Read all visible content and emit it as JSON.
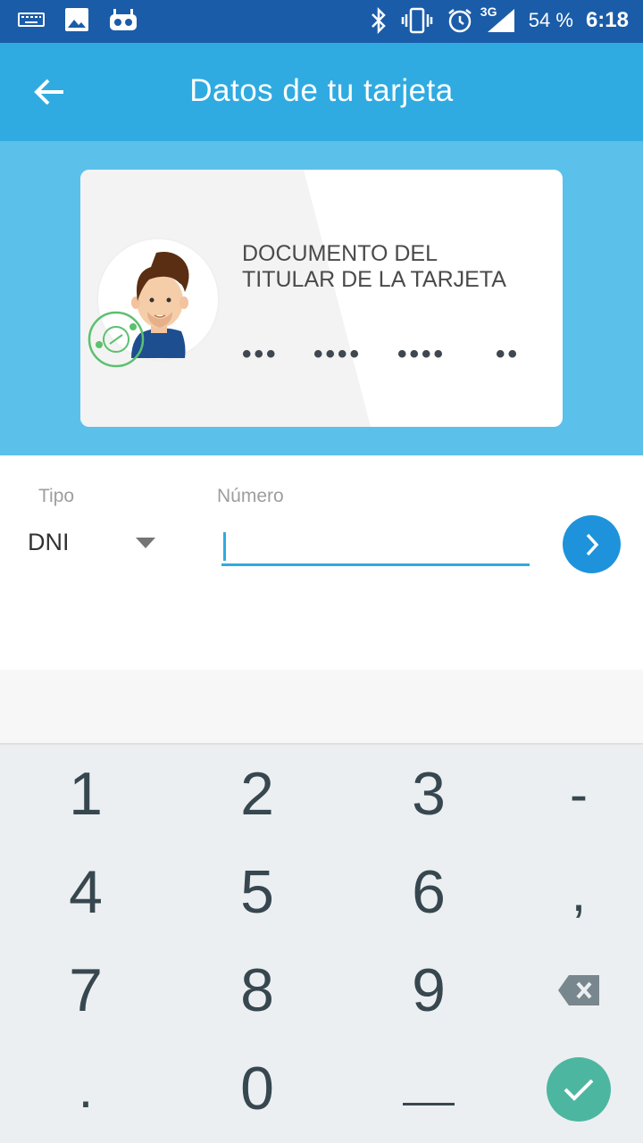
{
  "status_bar": {
    "network": "3G",
    "battery": "54 %",
    "time": "6:18",
    "icons": [
      "keyboard-icon",
      "image-icon",
      "robot-icon",
      "bluetooth-icon",
      "vibrate-icon",
      "alarm-icon",
      "signal-icon"
    ]
  },
  "app_bar": {
    "title": "Datos de tu tarjeta",
    "back_icon": "arrow-left-icon"
  },
  "card": {
    "title_line1": "DOCUMENTO DEL",
    "title_line2": "TITULAR DE LA TARJETA",
    "dots": [
      "•••",
      "••••",
      "••••",
      "••"
    ]
  },
  "form": {
    "tipo_label": "Tipo",
    "tipo_value": "DNI",
    "numero_label": "Número",
    "numero_value": "",
    "numero_placeholder": ""
  },
  "keypad": {
    "keys": [
      "1",
      "2",
      "3",
      "-",
      "4",
      "5",
      "6",
      ",",
      "7",
      "8",
      "9",
      "backspace",
      ".",
      "0",
      "_",
      "done"
    ]
  },
  "colors": {
    "status_bar": "#1a5ca8",
    "app_bar": "#2fabe1",
    "hero": "#5bc0ea",
    "accent": "#1e93dc",
    "done": "#4db6a0"
  }
}
